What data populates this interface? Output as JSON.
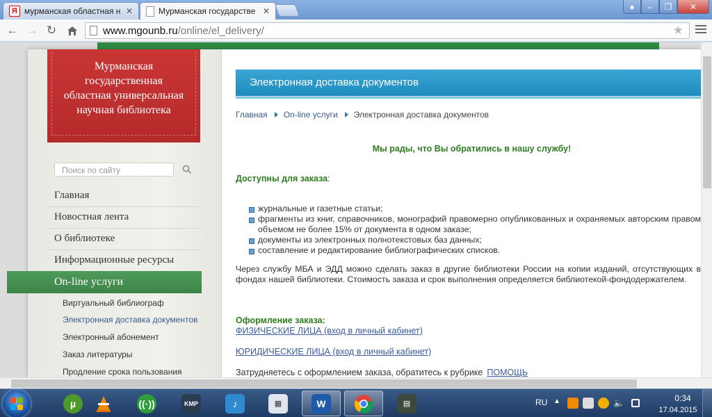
{
  "browser": {
    "tabs": [
      {
        "title": "мурманская областная н",
        "favicon": "yandex-icon",
        "active": false
      },
      {
        "title": "Мурманская государстве",
        "favicon": "page-icon",
        "active": true
      }
    ],
    "url_host": "www.mgounb.ru",
    "url_path": "/online/el_delivery/"
  },
  "site": {
    "logo_lines": [
      "Мурманская",
      "государственная",
      "областная универсальная",
      "научная библиотека"
    ],
    "search_placeholder": "Поиск по сайту",
    "nav": [
      {
        "label": "Главная"
      },
      {
        "label": "Новостная лента"
      },
      {
        "label": "О библиотеке"
      },
      {
        "label": "Информационные ресурсы"
      }
    ],
    "nav_active": "On-line услуги",
    "subnav": [
      {
        "label": "Виртуальный библиограф",
        "current": false
      },
      {
        "label": "Электронная доставка документов",
        "current": true
      },
      {
        "label": "Электронный абонемент",
        "current": false
      },
      {
        "label": "Заказ литературы",
        "current": false
      },
      {
        "label": "Продление срока пользования",
        "current": false
      }
    ]
  },
  "content": {
    "title": "Электронная доставка документов",
    "breadcrumbs": [
      "Главная",
      "On-line услуги",
      "Электронная доставка документов"
    ],
    "welcome": "Мы рады, что Вы обратились в нашу службу!",
    "available_label": "Доступны для заказа",
    "available_colon": ":",
    "items": [
      "журнальные и газетные статьи;",
      "фрагменты из книг, справочников, монографий правомерно опубликованных и охраняемых авторским правом объемом не более 15% от документа в одном заказе;",
      "документы из электронных полнотекстовых баз данных;",
      "составление и редактирование библиографических списков."
    ],
    "paragraph": "Через службу МБА и ЭДД можно сделать заказ в другие библиотеки России на копии изданий, отсутствующих в фондах нашей библиотеки. Стоимость заказа и срок выполнения определяется библиотекой-фондодержателем.",
    "order_label": "Оформление заказа:",
    "link_physical": "ФИЗИЧЕСКИЕ ЛИЦА (вход в личный кабинет)",
    "link_legal": "ЮРИДИЧЕСКИЕ ЛИЦА (вход в личный кабинет)",
    "help_text": "Затрудняетесь с оформлением заказа, обратитесь к рубрике",
    "help_link": "ПОМОЩЬ"
  },
  "taskbar": {
    "apps": [
      "utorrent-icon",
      "vlc-icon",
      "network-icon",
      "kmplayer-icon",
      "music-icon",
      "calculator-icon",
      "word-icon",
      "chrome-icon",
      "monitor-icon"
    ],
    "lang": "RU",
    "time": "0:34",
    "date": "17.04.2015"
  }
}
